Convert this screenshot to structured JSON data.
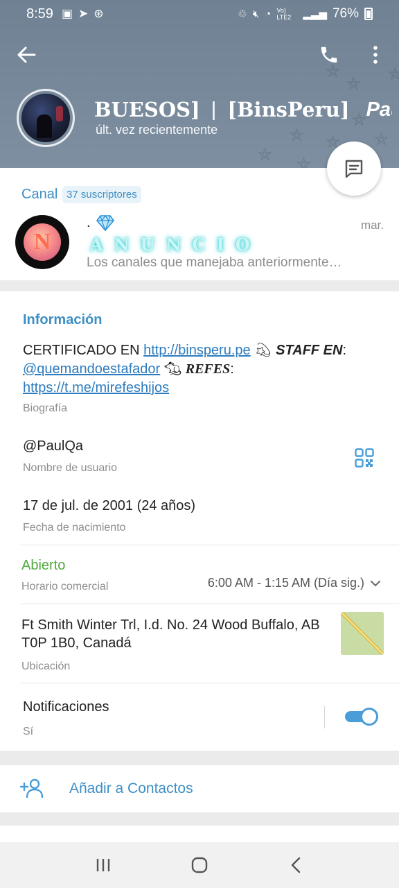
{
  "status_bar": {
    "time": "8:59",
    "battery": "76%",
    "network": "Vo) LTE2"
  },
  "header": {
    "name_part1": "BUESOS]",
    "name_sep": "|",
    "name_part2": "[BinsPeru]",
    "name_part3": "Paul",
    "last_seen": "últ. vez recientemente"
  },
  "channel": {
    "label": "Canal",
    "subscribers": "37 suscriptores",
    "title": ".",
    "date": "mar.",
    "anuncio": "ANUNCIO",
    "preview": "Los canales que manejaba anteriormente…"
  },
  "info": {
    "heading": "Información",
    "bio": {
      "certificado": "CERTIFICADO EN ",
      "link1": "http://binsperu.pe",
      "staff": "STAFF EN",
      "colon1": ":",
      "handle": "@quemandoestafador",
      "refes": "REFES",
      "colon2": ":",
      "link2": "https://t.me/mirefeshijos"
    },
    "bio_label": "Biografía",
    "username": "@PaulQa",
    "username_label": "Nombre de usuario",
    "birthday": "17 de jul. de 2001 (24 años)",
    "birthday_label": "Fecha de nacimiento",
    "business_status": "Abierto",
    "business_label": "Horario comercial",
    "hours": "6:00 AM - 1:15 AM (Día sig.)",
    "address": "Ft Smith Winter Trl, I.d. No. 24 Wood Buffalo, AB T0P 1B0, Canadá",
    "location_label": "Ubicación",
    "notifications_label": "Notificaciones",
    "notifications_value": "Sí",
    "notifications_on": true
  },
  "actions": {
    "add_contact": "Añadir a Contactos"
  },
  "colors": {
    "accent": "#3d8fc4",
    "open": "#4fa83d",
    "header_bg": "#76889a"
  }
}
